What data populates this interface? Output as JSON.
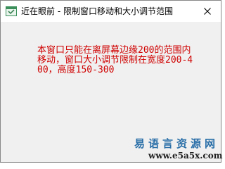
{
  "window": {
    "title": "近在眼前 - 限制窗口移动和大小调节范围",
    "icon": "app-window-icon",
    "close_icon": "close-icon"
  },
  "content": {
    "message": "本窗口只能在离屏幕边缘200的范围内移动，窗口大小调节限制在宽度200-400，高度150-300",
    "message_color": "#d00000"
  },
  "watermark": {
    "site_name": "易语言资源网",
    "url": "www.e5a5x.com"
  }
}
